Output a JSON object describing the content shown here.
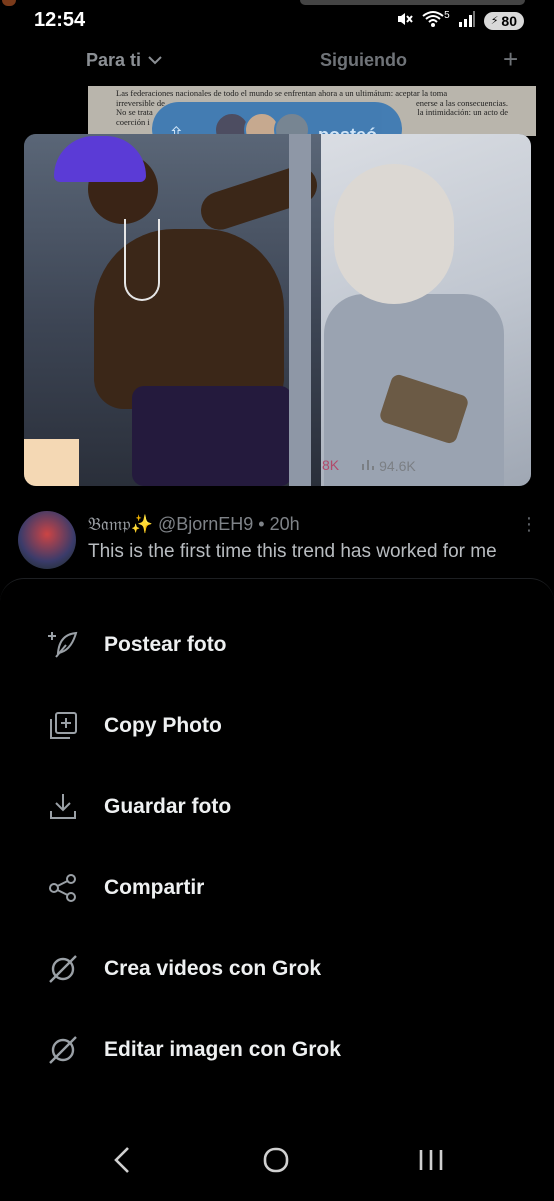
{
  "status": {
    "time": "12:54",
    "battery": "80",
    "network_superscript": "5"
  },
  "tabs": {
    "for_you": "Para ti",
    "following": "Siguiendo",
    "add": "+"
  },
  "feed": {
    "posted_banner": "posteó",
    "doc_snippet_line1": "Las federaciones nacionales de todo el mundo se enfrentan ahora a un ultimátum: aceptar la toma",
    "doc_snippet_line2": "irreversible de",
    "doc_snippet_line2b": "enerse a las consecuencias.",
    "doc_snippet_line3": "No se trata",
    "doc_snippet_line3b": "la intimidación: un acto de",
    "doc_snippet_line4": "coerción i",
    "engagement_likes": "8K",
    "engagement_views": "94.6K"
  },
  "tweet2": {
    "display_name": "𝔅𝔞𝔪𝔭✨",
    "handle": "@BjornEH9",
    "time": "• 20h",
    "text": "This is the first time this trend has worked for me"
  },
  "menu": [
    {
      "label": "Postear foto",
      "icon": "post-photo-icon"
    },
    {
      "label": "Copy Photo",
      "icon": "copy-photo-icon"
    },
    {
      "label": "Guardar foto",
      "icon": "download-icon"
    },
    {
      "label": "Compartir",
      "icon": "share-icon"
    },
    {
      "label": "Crea videos con Grok",
      "icon": "grok-icon"
    },
    {
      "label": "Editar imagen con Grok",
      "icon": "grok-icon"
    }
  ],
  "colors": {
    "background": "#000000",
    "text": "#eef0f1",
    "posted_pill": "#2f73b4"
  }
}
